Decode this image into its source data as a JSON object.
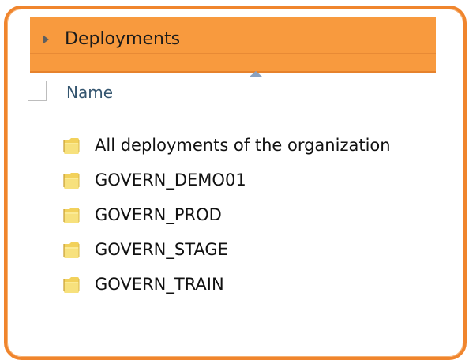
{
  "window": {
    "accent_border_color": "#f0852d",
    "header_fill_color": "#f89a3e"
  },
  "header": {
    "title": "Deployments",
    "expand_icon": "triangle-right-icon"
  },
  "column_header": {
    "name_label": "Name",
    "sort_indicator_icon": "sort-ascending-icon"
  },
  "folders": [
    {
      "label": "All deployments of the organization",
      "icon": "folder-icon"
    },
    {
      "label": "GOVERN_DEMO01",
      "icon": "folder-icon"
    },
    {
      "label": "GOVERN_PROD",
      "icon": "folder-icon"
    },
    {
      "label": "GOVERN_STAGE",
      "icon": "folder-icon"
    },
    {
      "label": "GOVERN_TRAIN",
      "icon": "folder-icon"
    }
  ]
}
